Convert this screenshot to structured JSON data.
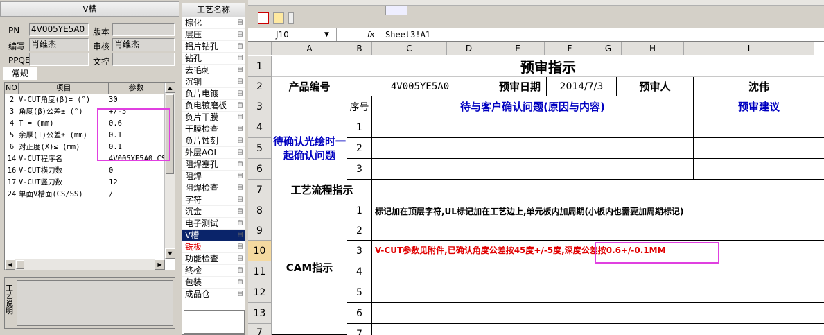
{
  "left_panel": {
    "title": "V槽",
    "fields": {
      "pn_label": "PN",
      "pn_value": "4V005YE5A0",
      "version_label": "版本",
      "version_value": "",
      "author_label": "编写",
      "author_value": "肖维杰",
      "review_label": "审核",
      "review_value": "肖维杰",
      "ppqe_label": "PPQE",
      "ppqe_value": "",
      "doc_label": "文控",
      "doc_value": ""
    },
    "tab": "常规",
    "grid_headers": {
      "no": "NO",
      "item": "项目",
      "param": "参数"
    },
    "rows": [
      {
        "no": "2",
        "item": "V-CUT角度(β)= (°)",
        "param": "30"
      },
      {
        "no": "3",
        "item": "角度(β)公差± (°)",
        "param": "+/-5"
      },
      {
        "no": "4",
        "item": "T = (mm)",
        "param": "0.6"
      },
      {
        "no": "5",
        "item": "余厚(T)公差± (mm)",
        "param": "0.1"
      },
      {
        "no": "6",
        "item": "对正度(X)≤ (mm)",
        "param": "0.1"
      },
      {
        "no": "14",
        "item": "V-CUT程序名",
        "param": "4V005YE5A0.CS"
      },
      {
        "no": "16",
        "item": "V-CUT横刀数",
        "param": "0"
      },
      {
        "no": "17",
        "item": "V-CUT竖刀数",
        "param": "12"
      },
      {
        "no": "24",
        "item": "单面V槽面(CS/SS)",
        "param": "/"
      }
    ],
    "note_label": "工艺说明"
  },
  "process_panel": {
    "header": "工艺名称",
    "items": [
      {
        "label": "棕化",
        "mark": "自"
      },
      {
        "label": "层压",
        "mark": "自"
      },
      {
        "label": "铝片钻孔",
        "mark": "自"
      },
      {
        "label": "钻孔",
        "mark": "自"
      },
      {
        "label": "去毛刺",
        "mark": "自"
      },
      {
        "label": "沉铜",
        "mark": "自"
      },
      {
        "label": "负片电镀",
        "mark": "自"
      },
      {
        "label": "负电镀磨板",
        "mark": "自"
      },
      {
        "label": "负片干膜",
        "mark": "自"
      },
      {
        "label": "干膜检查",
        "mark": "自"
      },
      {
        "label": "负片蚀刻",
        "mark": "自"
      },
      {
        "label": "外层AOI",
        "mark": "自"
      },
      {
        "label": "阻焊塞孔",
        "mark": "自"
      },
      {
        "label": "阻焊",
        "mark": "自"
      },
      {
        "label": "阻焊检查",
        "mark": "自"
      },
      {
        "label": "字符",
        "mark": "自"
      },
      {
        "label": "沉金",
        "mark": "自"
      },
      {
        "label": "电子测试",
        "mark": "自"
      },
      {
        "label": "V槽",
        "mark": "自"
      },
      {
        "label": "铣板",
        "mark": "自"
      },
      {
        "label": "功能检查",
        "mark": "自"
      },
      {
        "label": "终检",
        "mark": "自"
      },
      {
        "label": "包装",
        "mark": "自"
      },
      {
        "label": "成品仓",
        "mark": "自"
      }
    ]
  },
  "formula_bar": {
    "cell_ref": "J10",
    "fx": "fx",
    "content": "Sheet3!A1"
  },
  "sheet": {
    "columns": [
      "A",
      "B",
      "C",
      "D",
      "E",
      "F",
      "G",
      "H",
      "I"
    ],
    "rows": [
      "1",
      "2",
      "3",
      "4",
      "5",
      "6",
      "7",
      "8",
      "9",
      "10",
      "11",
      "12",
      "13",
      "7"
    ],
    "title": "预审指示",
    "product_no_label": "产品编号",
    "product_no_value": "4V005YE5A0",
    "pre_date_label": "预审日期",
    "pre_date_value": "2014/7/3",
    "reviewer_label": "预审人",
    "reviewer_value": "沈伟",
    "seq_label": "序号",
    "issues_label": "待与客户确认问题(原因与内容)",
    "suggest_label": "预审建议",
    "pending_label": "待确认光绘时一起确认问题",
    "pending_nums": [
      "1",
      "2",
      "3"
    ],
    "flow_label": "工艺流程指示",
    "cam_label": "CAM指示",
    "cam_nums": [
      "1",
      "2",
      "3",
      "4",
      "5",
      "6",
      "7"
    ],
    "cam_line1": "标记加在顶层字符,UL标记加在工艺边上,单元板内加周期(小板内也需要加周期标记)",
    "cam_line3": "V-CUT参数见附件,已确认角度公差按45度+/-5度,深度公差按0.6+/-0.1MM"
  }
}
